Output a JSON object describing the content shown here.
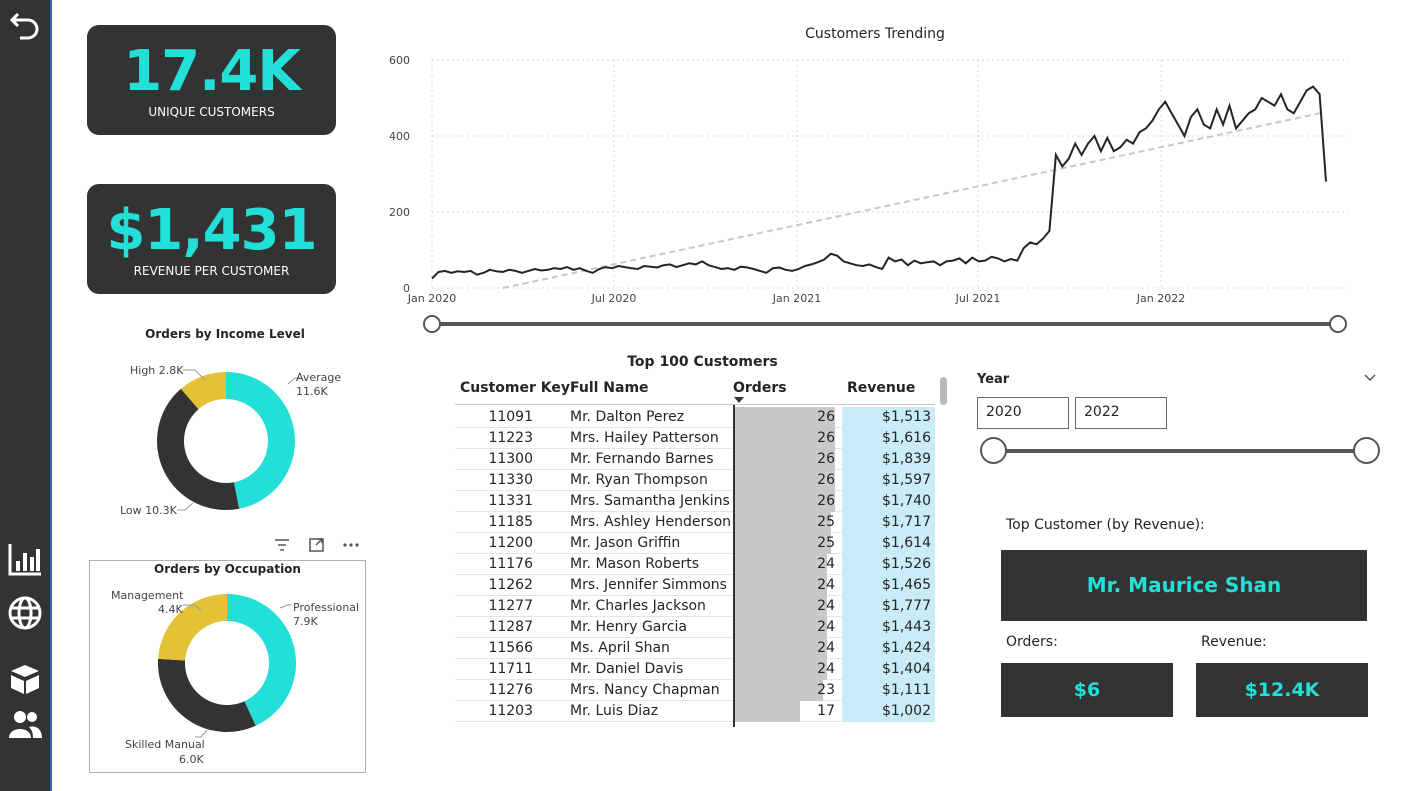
{
  "kpis": {
    "unique_customers": {
      "value": "17.4K",
      "label": "UNIQUE CUSTOMERS"
    },
    "revenue_per_customer": {
      "value": "$1,431",
      "label": "REVENUE PER CUSTOMER"
    }
  },
  "trend": {
    "title": "Customers Trending",
    "y_ticks": [
      "600",
      "400",
      "200",
      "0"
    ],
    "x_ticks": [
      "Jan 2020",
      "Jul 2020",
      "Jan 2021",
      "Jul 2021",
      "Jan 2022"
    ]
  },
  "income_donut": {
    "title": "Orders by Income Level",
    "labels": {
      "high": "High 2.8K",
      "average_name": "Average",
      "average_val": "11.6K",
      "low": "Low 10.3K"
    }
  },
  "occupation_donut": {
    "title": "Orders by Occupation",
    "labels": {
      "management_name": "Management",
      "management_val": "4.4K",
      "professional_name": "Professional",
      "professional_val": "7.9K",
      "skilled_name": "Skilled Manual",
      "skilled_val": "6.0K"
    }
  },
  "table": {
    "title": "Top 100 Customers",
    "headers": {
      "key": "Customer Key",
      "name": "Full Name",
      "orders": "Orders",
      "revenue": "Revenue"
    },
    "rows": [
      {
        "key": "11091",
        "name": "Mr. Dalton Perez",
        "orders": "26",
        "revenue": "$1,513"
      },
      {
        "key": "11223",
        "name": "Mrs. Hailey Patterson",
        "orders": "26",
        "revenue": "$1,616"
      },
      {
        "key": "11300",
        "name": "Mr. Fernando Barnes",
        "orders": "26",
        "revenue": "$1,839"
      },
      {
        "key": "11330",
        "name": "Mr. Ryan Thompson",
        "orders": "26",
        "revenue": "$1,597"
      },
      {
        "key": "11331",
        "name": "Mrs. Samantha Jenkins",
        "orders": "26",
        "revenue": "$1,740"
      },
      {
        "key": "11185",
        "name": "Mrs. Ashley Henderson",
        "orders": "25",
        "revenue": "$1,717"
      },
      {
        "key": "11200",
        "name": "Mr. Jason Griffin",
        "orders": "25",
        "revenue": "$1,614"
      },
      {
        "key": "11176",
        "name": "Mr. Mason Roberts",
        "orders": "24",
        "revenue": "$1,526"
      },
      {
        "key": "11262",
        "name": "Mrs. Jennifer Simmons",
        "orders": "24",
        "revenue": "$1,465"
      },
      {
        "key": "11277",
        "name": "Mr. Charles Jackson",
        "orders": "24",
        "revenue": "$1,777"
      },
      {
        "key": "11287",
        "name": "Mr. Henry Garcia",
        "orders": "24",
        "revenue": "$1,443"
      },
      {
        "key": "11566",
        "name": "Ms. April Shan",
        "orders": "24",
        "revenue": "$1,424"
      },
      {
        "key": "11711",
        "name": "Mr. Daniel Davis",
        "orders": "24",
        "revenue": "$1,404"
      },
      {
        "key": "11276",
        "name": "Mrs. Nancy Chapman",
        "orders": "23",
        "revenue": "$1,111"
      },
      {
        "key": "11203",
        "name": "Mr. Luis Diaz",
        "orders": "17",
        "revenue": "$1,002"
      }
    ]
  },
  "year_slicer": {
    "label": "Year",
    "from": "2020",
    "to": "2022"
  },
  "top_customer": {
    "heading": "Top Customer (by Revenue):",
    "name": "Mr. Maurice Shan",
    "orders_label": "Orders:",
    "orders_value": "$6",
    "revenue_label": "Revenue:",
    "revenue_value": "$12.4K"
  },
  "colors": {
    "accent": "#22e0d8",
    "yellow": "#e3c235",
    "dark": "#333333"
  },
  "icons": [
    "back-arrow-icon",
    "bar-chart-icon",
    "globe-icon",
    "box-icon",
    "users-icon",
    "filter-icon",
    "expand-icon",
    "more-options-icon",
    "chevron-down-icon"
  ],
  "chart_data": [
    {
      "type": "line",
      "title": "Customers Trending",
      "ylim": [
        0,
        600
      ],
      "x_range": [
        "2020-01",
        "2022-07"
      ],
      "series": [
        {
          "values": [
            25,
            42,
            45,
            40,
            44,
            42,
            45,
            35,
            40,
            48,
            44,
            42,
            48,
            45,
            40,
            45,
            50,
            46,
            48,
            52,
            50,
            55,
            48,
            52,
            45,
            40,
            50,
            55,
            52,
            58,
            55,
            52,
            50,
            58,
            56,
            54,
            60,
            62,
            55,
            60,
            65,
            62,
            70,
            60,
            55,
            50,
            52,
            48,
            56,
            54,
            50,
            45,
            40,
            52,
            54,
            48,
            45,
            50,
            58,
            62,
            68,
            75,
            90,
            85,
            70,
            65,
            60,
            58,
            62,
            55,
            50,
            80,
            70,
            75,
            60,
            72,
            65,
            68,
            70,
            60,
            70,
            72,
            78,
            65,
            80,
            70,
            72,
            82,
            78,
            70,
            76,
            72,
            105,
            120,
            115,
            130,
            150,
            350,
            320,
            340,
            380,
            350,
            380,
            400,
            360,
            395,
            360,
            370,
            390,
            380,
            410,
            420,
            440,
            470,
            490,
            460,
            430,
            400,
            450,
            470,
            430,
            420,
            470,
            430,
            480,
            420,
            440,
            460,
            470,
            500,
            490,
            480,
            510,
            470,
            460,
            490,
            520,
            530,
            510,
            280
          ]
        },
        {
          "type": "trend",
          "values": [
            -40,
            460
          ]
        }
      ]
    },
    {
      "type": "pie",
      "title": "Orders by Income Level",
      "categories": [
        "Average",
        "Low",
        "High"
      ],
      "values": [
        11.6,
        10.3,
        2.8
      ]
    },
    {
      "type": "pie",
      "title": "Orders by Occupation",
      "categories": [
        "Professional",
        "Skilled Manual",
        "Management"
      ],
      "values": [
        7.9,
        6.0,
        4.4
      ]
    }
  ]
}
